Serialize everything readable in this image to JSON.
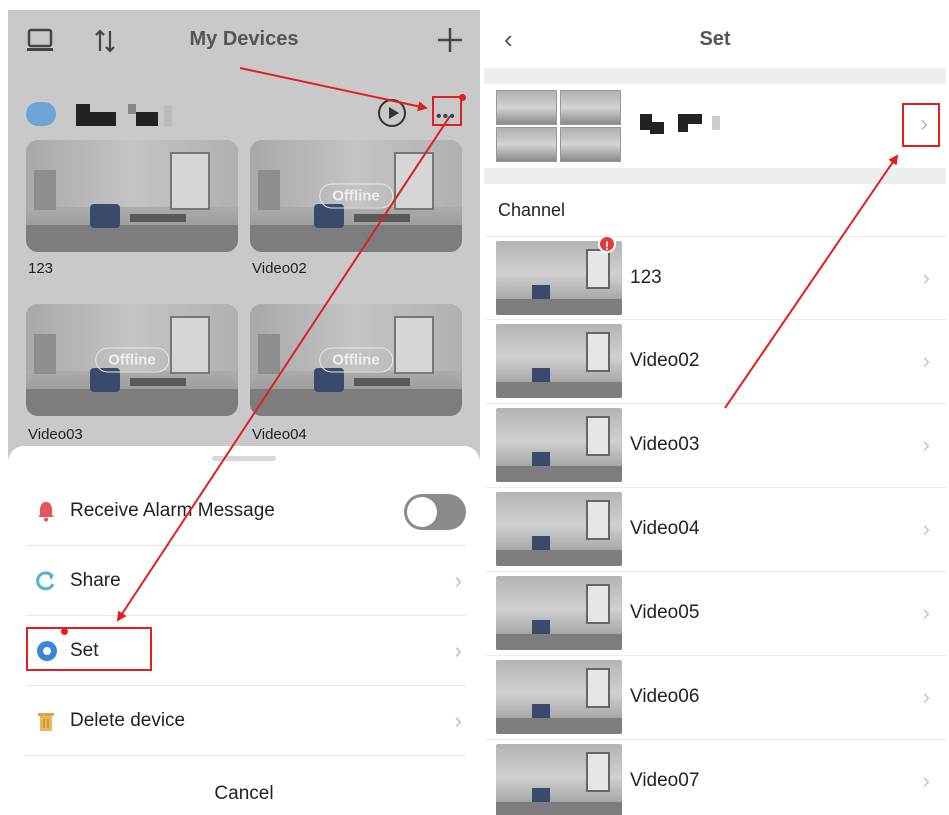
{
  "left": {
    "header": {
      "title": "My Devices",
      "monitor_icon": "monitor-icon",
      "sort_icon": "sort-icon",
      "add_icon": "plus-icon"
    },
    "cameras": [
      {
        "label": "123",
        "status": ""
      },
      {
        "label": "Video02",
        "status": "Offline"
      },
      {
        "label": "Video03",
        "status": "Offline"
      },
      {
        "label": "Video04",
        "status": "Offline"
      }
    ],
    "sheet": {
      "items": [
        {
          "label": "Receive Alarm Message",
          "icon": "bell-icon"
        },
        {
          "label": "Share",
          "icon": "share-icon"
        },
        {
          "label": "Set",
          "icon": "gear-icon"
        },
        {
          "label": "Delete device",
          "icon": "trash-icon"
        }
      ],
      "cancel": "Cancel"
    }
  },
  "right": {
    "header": {
      "title": "Set"
    },
    "channel_header": "Channel",
    "channels": [
      "123",
      "Video02",
      "Video03",
      "Video04",
      "Video05",
      "Video06",
      "Video07"
    ],
    "alert_badge": "!"
  },
  "colors": {
    "annotation": "#e02020",
    "alarm_icon": "#e5555a",
    "share_icon": "#4fb3c9",
    "set_icon": "#3a86d6",
    "delete_icon": "#d9a441"
  }
}
